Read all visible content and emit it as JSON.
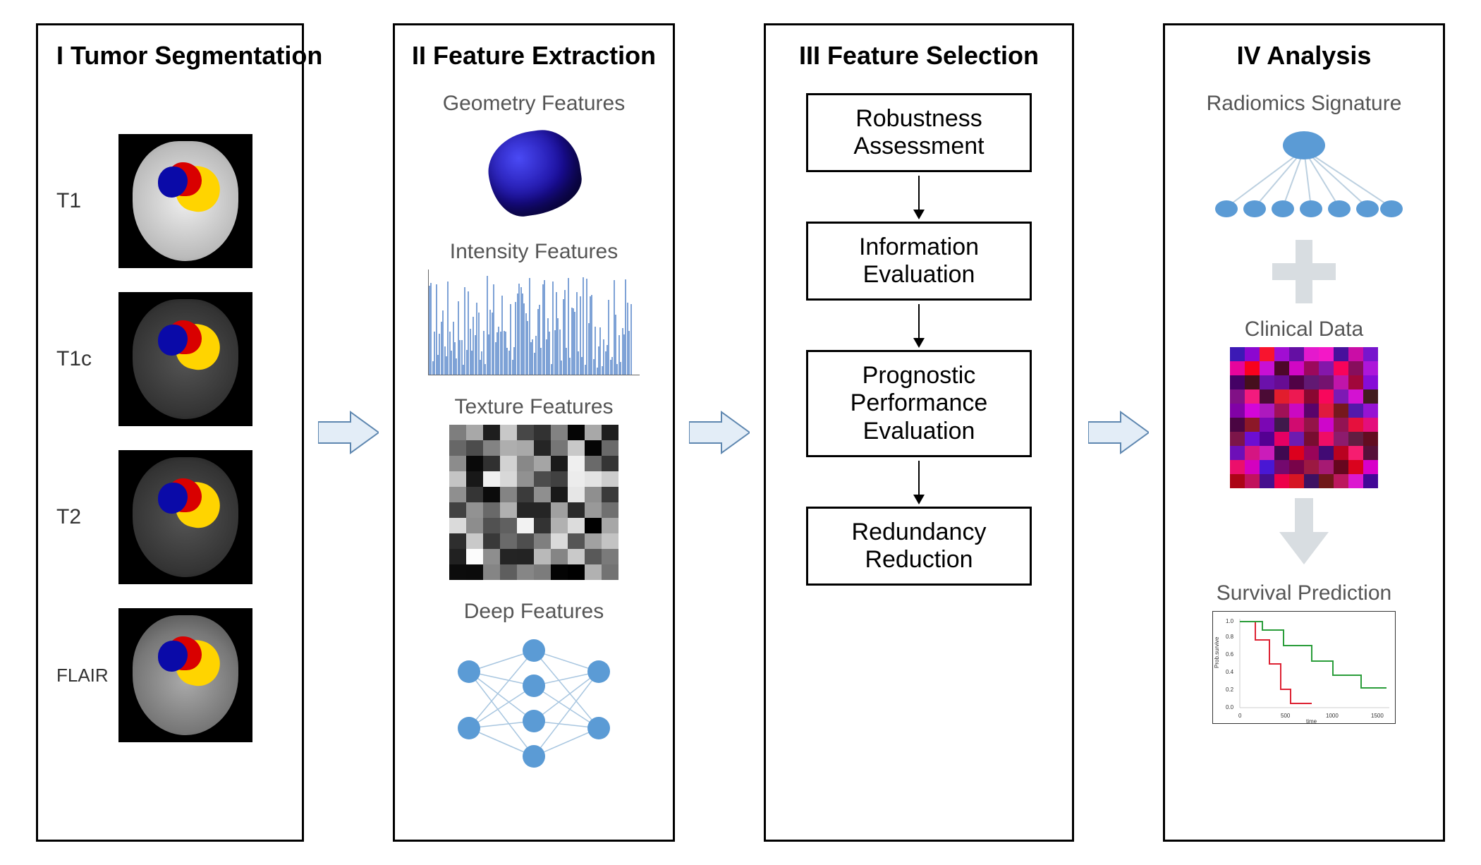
{
  "panels": {
    "p1": {
      "title": "I  Tumor Segmentation",
      "items": [
        "T1",
        "T1c",
        "T2",
        "FLAIR"
      ]
    },
    "p2": {
      "title": "II  Feature Extraction",
      "subs": [
        "Geometry Features",
        "Intensity Features",
        "Texture Features",
        "Deep Features"
      ]
    },
    "p3": {
      "title": "III Feature Selection",
      "steps": [
        "Robustness Assessment",
        "Information Evaluation",
        "Prognostic Performance Evaluation",
        "Redundancy Reduction"
      ]
    },
    "p4": {
      "title": "IV  Analysis",
      "subs": [
        "Radiomics Signature",
        "Clinical Data",
        "Survival Prediction"
      ],
      "km": {
        "ylabel": "Prob.survive",
        "xlabel": "time",
        "xticks": [
          "0",
          "500",
          "1000",
          "1500"
        ],
        "yticks": [
          "0.0",
          "0.2",
          "0.4",
          "0.6",
          "0.8",
          "1.0"
        ]
      }
    }
  }
}
